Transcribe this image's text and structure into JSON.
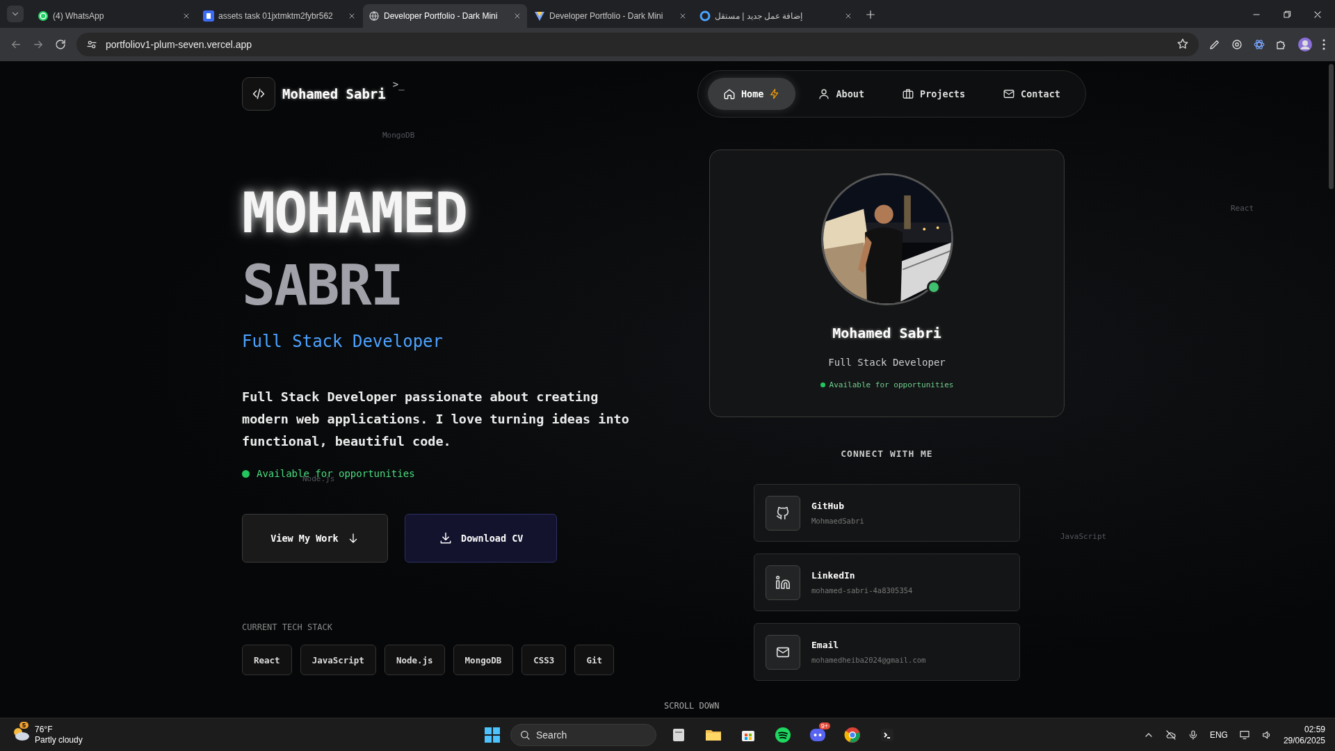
{
  "browser": {
    "tabs": [
      {
        "title": "(4) WhatsApp",
        "kind": "chat",
        "selected": false
      },
      {
        "title": "assets task 01jxtmktm2fybr562",
        "kind": "letter",
        "selected": false
      },
      {
        "title": "Developer Portfolio - Dark Mini",
        "kind": "globe",
        "selected": true
      },
      {
        "title": "Developer Portfolio - Dark Mini",
        "kind": "triangle",
        "selected": false
      },
      {
        "title": "إضافة عمل جديد | مستقل",
        "kind": "ring",
        "selected": false
      }
    ],
    "url": "portfoliov1-plum-seven.vercel.app"
  },
  "site": {
    "logo_name": "Mohamed Sabri",
    "logo_prompt": ">_",
    "nav": [
      {
        "label": "Home",
        "kind": "home",
        "selected": true
      },
      {
        "label": "About",
        "kind": "user",
        "selected": false
      },
      {
        "label": "Projects",
        "kind": "briefcase",
        "selected": false
      },
      {
        "label": "Contact",
        "kind": "mail",
        "selected": false
      }
    ],
    "hero": {
      "first_name": "MOHAMED",
      "last_name": "SABRI",
      "role": "Full Stack Developer",
      "bio": "Full Stack Developer passionate about creating modern web applications. I love turning ideas into functional, beautiful code.",
      "status": "Available for opportunities"
    },
    "buttons": [
      {
        "label": "View My Work",
        "kind": "secondary"
      },
      {
        "label": "Download CV",
        "kind": "primary"
      }
    ],
    "tech_stack": {
      "label": "CURRENT TECH STACK",
      "items": [
        "React",
        "JavaScript",
        "Node.js",
        "MongoDB",
        "CSS3",
        "Git"
      ]
    },
    "profile": {
      "kind": "picture",
      "name": "Mohamed Sabri",
      "role": "Full Stack Developer",
      "status": "Available for opportunities",
      "online": true
    },
    "connect": {
      "heading": "CONNECT WITH ME",
      "links": [
        {
          "kind": "github",
          "title": "GitHub",
          "handle": "MohmaedSabri"
        },
        {
          "kind": "linkedin",
          "title": "LinkedIn",
          "handle": "mohamed-sabri-4a8305354"
        },
        {
          "kind": "email",
          "title": "Email",
          "handle": "mohamedheiba2024@gmail.com"
        }
      ]
    },
    "scroll_hint": "SCROLL DOWN",
    "background_words": [
      "MongoDB",
      "React",
      "Node.js",
      "JavaScript"
    ]
  },
  "taskbar": {
    "weather": {
      "temperature": "76°F",
      "condition": "Partly cloudy",
      "badge": "5"
    },
    "search": {
      "placeholder": "Search"
    },
    "apps": [
      {
        "kind": "files"
      },
      {
        "kind": "folder"
      },
      {
        "kind": "store"
      },
      {
        "kind": "music"
      },
      {
        "kind": "chat",
        "badge": "9+"
      },
      {
        "kind": "browser"
      },
      {
        "kind": "terminal"
      }
    ],
    "language": "ENG",
    "time": "02:59",
    "date": "29/06/2025"
  }
}
